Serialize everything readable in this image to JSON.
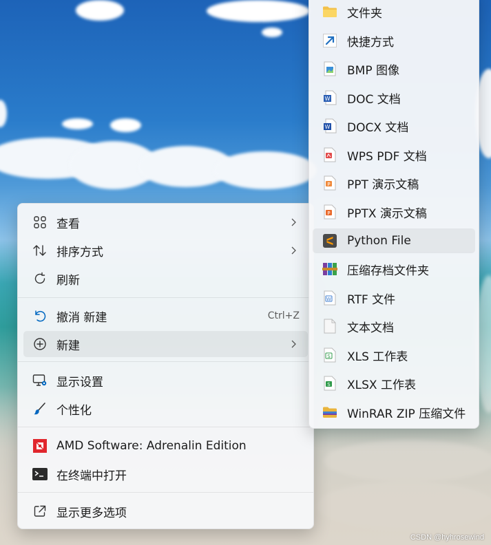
{
  "context_menu": {
    "items": [
      {
        "label": "查看",
        "icon": "grid-view-icon",
        "submenu": true
      },
      {
        "label": "排序方式",
        "icon": "sort-arrows-icon",
        "submenu": true
      },
      {
        "label": "刷新",
        "icon": "refresh-icon",
        "submenu": false
      },
      {
        "label": "撤消 新建",
        "icon": "undo-icon",
        "shortcut": "Ctrl+Z"
      },
      {
        "label": "新建",
        "icon": "new-plus-icon",
        "submenu": true
      },
      {
        "label": "显示设置",
        "icon": "display-settings-icon"
      },
      {
        "label": "个性化",
        "icon": "paintbrush-icon"
      },
      {
        "label": "AMD Software: Adrenalin Edition",
        "icon": "amd-logo-icon"
      },
      {
        "label": "在终端中打开",
        "icon": "terminal-icon"
      },
      {
        "label": "显示更多选项",
        "icon": "show-more-options-icon"
      }
    ],
    "active_item": "新建"
  },
  "new_submenu": {
    "items": [
      {
        "label": "文件夹",
        "icon": "folder-icon"
      },
      {
        "label": "快捷方式",
        "icon": "shortcut-arrow-icon"
      },
      {
        "label": "BMP 图像",
        "icon": "bmp-image-icon"
      },
      {
        "label": "DOC 文档",
        "icon": "word-doc-icon"
      },
      {
        "label": "DOCX 文档",
        "icon": "word-docx-icon"
      },
      {
        "label": "WPS PDF 文档",
        "icon": "pdf-icon"
      },
      {
        "label": "PPT 演示文稿",
        "icon": "ppt-icon"
      },
      {
        "label": "PPTX 演示文稿",
        "icon": "pptx-icon"
      },
      {
        "label": "Python File",
        "icon": "sublime-python-icon"
      },
      {
        "label": "压缩存档文件夹",
        "icon": "winrar-archive-icon"
      },
      {
        "label": "RTF 文件",
        "icon": "rtf-icon"
      },
      {
        "label": "文本文档",
        "icon": "text-document-icon"
      },
      {
        "label": "XLS 工作表",
        "icon": "xls-icon"
      },
      {
        "label": "XLSX 工作表",
        "icon": "xlsx-icon"
      },
      {
        "label": "WinRAR ZIP 压缩文件",
        "icon": "winrar-zip-icon"
      }
    ],
    "active_item": "Python File"
  },
  "watermark": "CSDN @hyhrosewind",
  "colors": {
    "accent": "#0067c0",
    "menu_bg": "#f6f7f9",
    "amd_red": "#e1262d"
  }
}
